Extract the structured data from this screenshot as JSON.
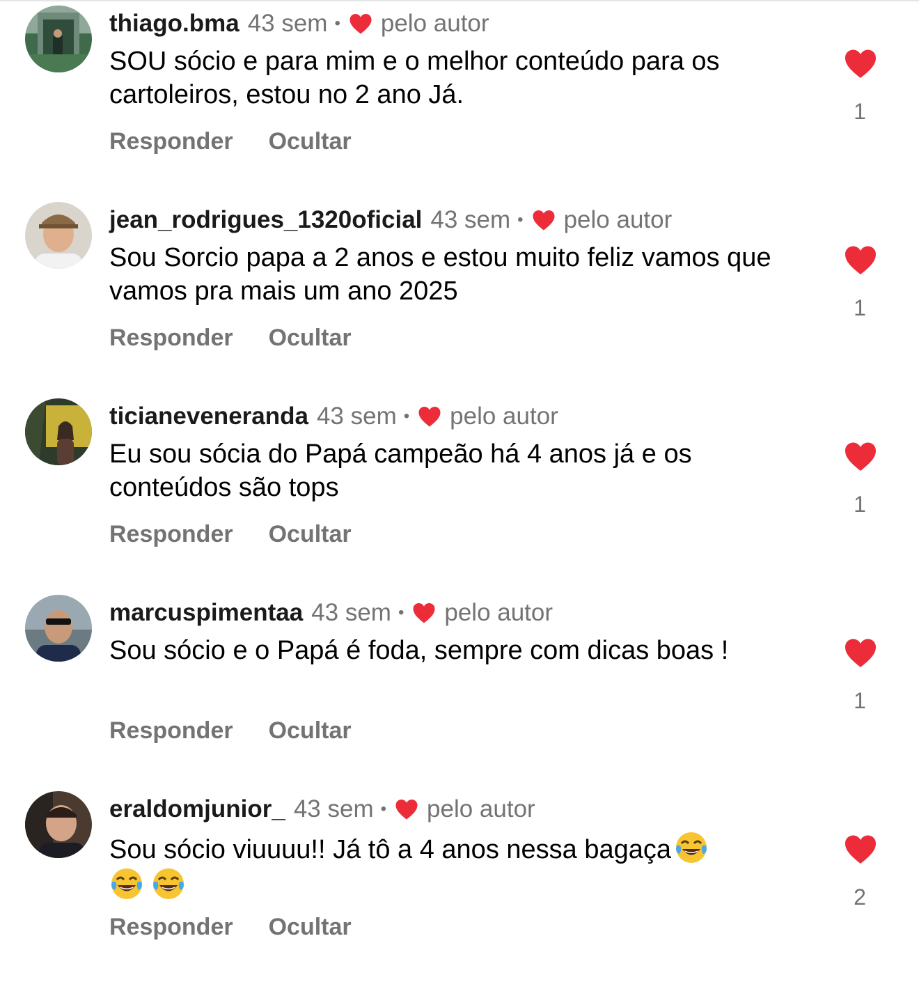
{
  "colors": {
    "heart": "#ed2c3a",
    "secondary_text": "#737373",
    "primary_text": "#000000"
  },
  "labels": {
    "reply": "Responder",
    "hide": "Ocultar",
    "liked_by_author": "pelo autor"
  },
  "comments": [
    {
      "username": "thiago.bma",
      "time": "43 sem",
      "text": "SOU sócio  e para mim e o melhor conteúdo para os cartoleiros, estou no 2 ano Já.",
      "likes": "1"
    },
    {
      "username": "jean_rodrigues_1320oficial",
      "time": "43 sem",
      "text": "Sou Sorcio papa a 2 anos e estou muito feliz vamos que vamos pra mais um ano 2025",
      "likes": "1"
    },
    {
      "username": "ticianeveneranda",
      "time": "43 sem",
      "text": "Eu sou sócia do Papá campeão há 4 anos já e os conteúdos são tops",
      "likes": "1"
    },
    {
      "username": "marcuspimentaa",
      "time": "43 sem",
      "text": "Sou sócio e o Papá é foda, sempre com dicas boas !",
      "likes": "1"
    },
    {
      "username": "eraldomjunior_",
      "time": "43 sem",
      "text": "Sou sócio viuuuu!! Já tô a 4 anos nessa bagaça",
      "emojis": "😂😂😂",
      "likes": "2"
    }
  ]
}
